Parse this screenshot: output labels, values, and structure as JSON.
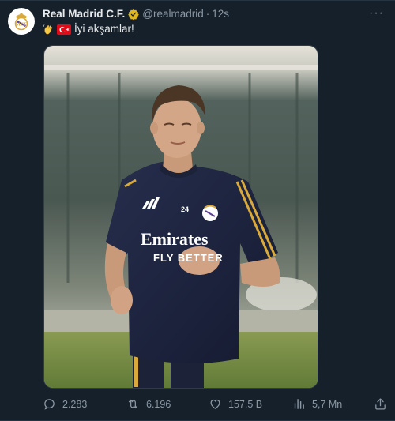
{
  "tweet": {
    "account": {
      "name": "Real Madrid C.F.",
      "handle": "@realmadrid",
      "separator": "·",
      "time": "12s",
      "verified": true
    },
    "text": "İyi akşamlar!",
    "emojis": [
      "waving-hand",
      "flag-turkey"
    ],
    "media": {
      "type": "photo",
      "jersey_sponsor_line1": "Emirates",
      "jersey_sponsor_line2": "FLY BETTER",
      "jersey_number": "24"
    },
    "actions": {
      "replies": "2.283",
      "reposts": "6.196",
      "likes": "157,5 B",
      "views": "5,7 Mn"
    }
  },
  "colors": {
    "background": "#15202b",
    "text_primary": "#e7e9ea",
    "text_secondary": "#8b98a5",
    "verified_gold": "#e2b719",
    "jersey_navy": "#1d2440",
    "jersey_gold": "#d9a93b"
  }
}
